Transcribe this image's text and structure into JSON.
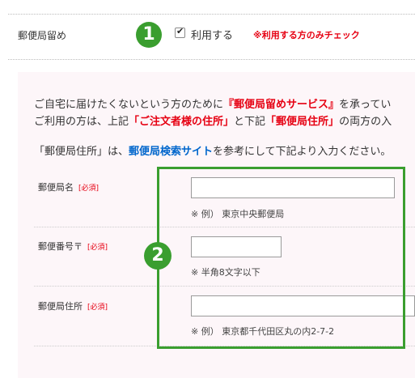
{
  "pickup_row": {
    "label": "郵便局留め",
    "step1": "1",
    "checkbox_label": "利用する",
    "checked": true,
    "note": "※利用する方のみチェック"
  },
  "intro": {
    "line1_a": "ご自宅に届けたくないという方のために",
    "line1_b": "『郵便局留めサービス』",
    "line1_c": "を承ってい",
    "line2_a": "ご利用の方は、上記",
    "line2_b": "「ご注文者様の住所」",
    "line2_c": "と下記",
    "line2_d": "「郵便局住所」",
    "line2_e": "の両方の入",
    "line3_a": "「郵便局住所」は、",
    "line3_link": "郵便局検索サイト",
    "line3_b": "を参考にして下記より入力ください。"
  },
  "step2": "2",
  "fields": [
    {
      "label": "郵便局名",
      "required": "[必須]",
      "value": "",
      "hint": "※ 例） 東京中央郵便局"
    },
    {
      "label": "郵便番号〒",
      "required": "[必須]",
      "value": "",
      "hint": "※ 半角8文字以下"
    },
    {
      "label": "郵便局住所",
      "required": "[必須]",
      "value": "",
      "hint": "※ 例） 東京都千代田区丸の内2-7-2"
    }
  ],
  "colors": {
    "accent_green": "#3a9e2f",
    "required_red": "#e60012",
    "link_blue": "#0066cc",
    "panel_pink": "#fdf6f9"
  }
}
